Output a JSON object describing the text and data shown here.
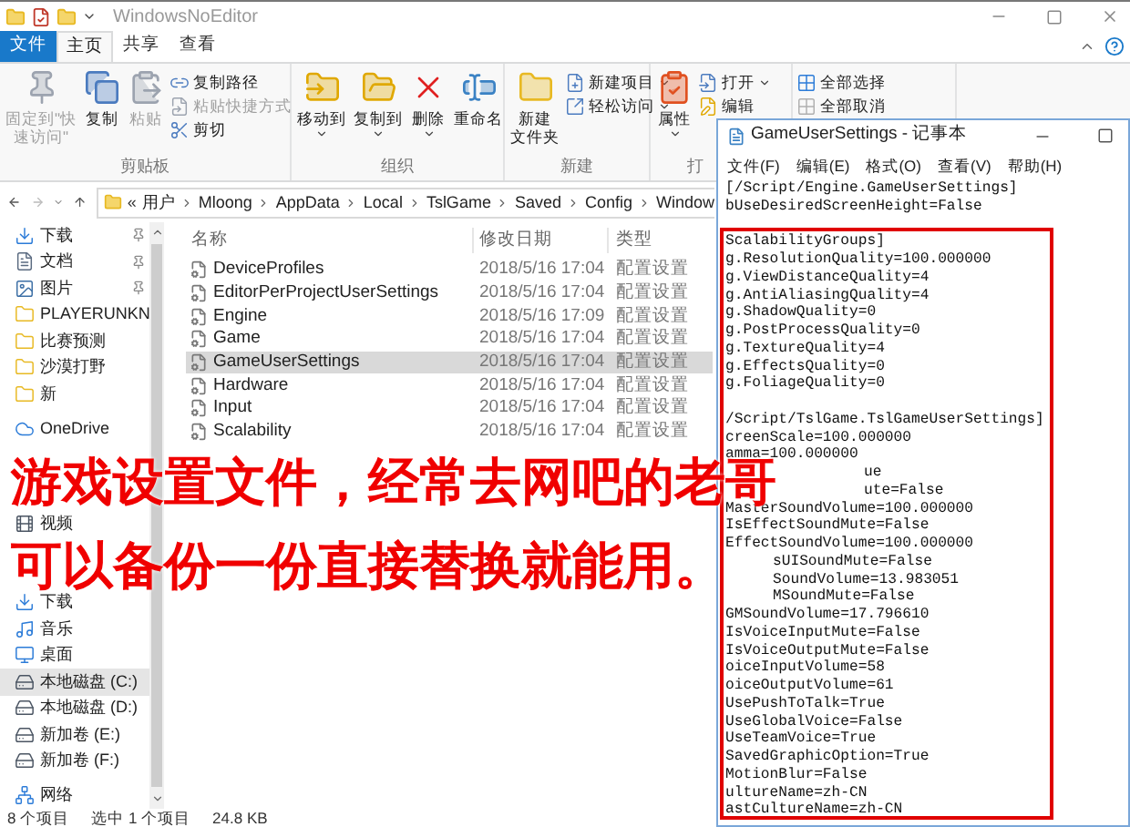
{
  "explorer": {
    "title": "WindowsNoEditor",
    "file_tab": "文件",
    "ribbon_tabs": [
      {
        "label": "主页",
        "selected": true
      },
      {
        "label": "共享",
        "selected": false
      },
      {
        "label": "查看",
        "selected": false
      }
    ],
    "ribbon_groups": [
      {
        "label": "剪贴板",
        "items": [
          {
            "label_lines": [
              "固定到\"快",
              "速访问\""
            ],
            "kind": "large",
            "disabled": true,
            "menu": false
          },
          {
            "label": "复制",
            "kind": "large",
            "disabled": false,
            "menu": false
          },
          {
            "label": "粘贴",
            "kind": "large",
            "disabled": true,
            "menu": false
          },
          {
            "label": "复制路径",
            "kind": "small",
            "disabled": false,
            "menu": false
          },
          {
            "label": "粘贴快捷方式",
            "kind": "small",
            "disabled": true,
            "menu": false
          },
          {
            "label": "剪切",
            "kind": "small",
            "disabled": false,
            "menu": false
          }
        ]
      },
      {
        "label": "组织",
        "items": [
          {
            "label": "移动到",
            "kind": "large",
            "disabled": false,
            "menu": true
          },
          {
            "label": "复制到",
            "kind": "large",
            "disabled": false,
            "menu": true
          },
          {
            "label": "删除",
            "kind": "large",
            "disabled": false,
            "menu": true
          },
          {
            "label": "重命名",
            "kind": "large",
            "disabled": false,
            "menu": false
          }
        ]
      },
      {
        "label": "新建",
        "items": [
          {
            "label_lines": [
              "新建",
              "文件夹"
            ],
            "kind": "large",
            "disabled": false,
            "menu": false
          },
          {
            "label": "新建项目",
            "kind": "small",
            "disabled": false,
            "menu": true
          },
          {
            "label": "轻松访问",
            "kind": "small",
            "disabled": false,
            "menu": true
          }
        ]
      },
      {
        "label": "打",
        "items": [
          {
            "label": "属性",
            "kind": "large",
            "disabled": false,
            "menu": true
          },
          {
            "label": "打开",
            "kind": "small",
            "disabled": false,
            "menu": true
          },
          {
            "label": "编辑",
            "kind": "small",
            "disabled": false,
            "menu": false
          }
        ]
      },
      {
        "items": [
          {
            "label": "全部选择",
            "kind": "small",
            "disabled": false,
            "menu": false
          },
          {
            "label": "全部取消",
            "kind": "small",
            "disabled": false,
            "menu": false
          }
        ]
      }
    ],
    "address": {
      "overflow": "«",
      "crumbs": [
        "用户",
        "Mloong",
        "AppData",
        "Local",
        "TslGame",
        "Saved",
        "Config",
        "Window"
      ]
    },
    "nav": [
      {
        "label": "下载",
        "kind": "download",
        "pinned": true,
        "selected": false
      },
      {
        "label": "文档",
        "kind": "document",
        "pinned": true,
        "selected": false
      },
      {
        "label": "图片",
        "kind": "picture",
        "pinned": true,
        "selected": false
      },
      {
        "label": "PLAYERUNKN",
        "kind": "folder",
        "pinned": false,
        "selected": false
      },
      {
        "label": "比赛预测",
        "kind": "folder",
        "pinned": false,
        "selected": false
      },
      {
        "label": "沙漠打野",
        "kind": "folder",
        "pinned": false,
        "selected": false
      },
      {
        "label": "新",
        "kind": "folder",
        "pinned": false,
        "selected": false
      },
      {
        "label": "OneDrive",
        "kind": "cloud",
        "pinned": false,
        "selected": false
      },
      {
        "kind": "covered"
      },
      {
        "kind": "covered"
      },
      {
        "label": "视频",
        "kind": "video",
        "pinned": false,
        "selected": false
      },
      {
        "kind": "covered"
      },
      {
        "kind": "covered"
      },
      {
        "label": "下载",
        "kind": "download",
        "pinned": false,
        "selected": false
      },
      {
        "label": "音乐",
        "kind": "music",
        "pinned": false,
        "selected": false
      },
      {
        "label": "桌面",
        "kind": "desktop",
        "pinned": false,
        "selected": false
      },
      {
        "label": "本地磁盘 (C:)",
        "kind": "drive",
        "pinned": false,
        "selected": true
      },
      {
        "label": "本地磁盘 (D:)",
        "kind": "drive",
        "pinned": false,
        "selected": false
      },
      {
        "label": "新加卷 (E:)",
        "kind": "drive",
        "pinned": false,
        "selected": false
      },
      {
        "label": "新加卷 (F:)",
        "kind": "drive",
        "pinned": false,
        "selected": false
      },
      {
        "label": "网络",
        "kind": "network",
        "pinned": false,
        "selected": false
      }
    ],
    "columns": [
      "名称",
      "修改日期",
      "类型"
    ],
    "files": [
      {
        "name": "DeviceProfiles",
        "modified": "2018/5/16 17:04",
        "type": "配置设置",
        "selected": false
      },
      {
        "name": "EditorPerProjectUserSettings",
        "modified": "2018/5/16 17:04",
        "type": "配置设置",
        "selected": false
      },
      {
        "name": "Engine",
        "modified": "2018/5/16 17:09",
        "type": "配置设置",
        "selected": false
      },
      {
        "name": "Game",
        "modified": "2018/5/16 17:04",
        "type": "配置设置",
        "selected": false
      },
      {
        "name": "GameUserSettings",
        "modified": "2018/5/16 17:04",
        "type": "配置设置",
        "selected": true
      },
      {
        "name": "Hardware",
        "modified": "2018/5/16 17:04",
        "type": "配置设置",
        "selected": false
      },
      {
        "name": "Input",
        "modified": "2018/5/16 17:04",
        "type": "配置设置",
        "selected": false
      },
      {
        "name": "Scalability",
        "modified": "2018/5/16 17:04",
        "type": "配置设置",
        "selected": false
      }
    ],
    "status_bar": [
      "8 个项目",
      "选中 1 个项目",
      "24.8 KB"
    ]
  },
  "notepad": {
    "title": "GameUserSettings - 记事本",
    "menu": [
      "文件(F)",
      "编辑(E)",
      "格式(O)",
      "查看(V)",
      "帮助(H)"
    ],
    "lines": [
      {
        "kind": "text",
        "text": "[/Script/Engine.GameUserSettings]"
      },
      {
        "kind": "text",
        "text": "bUseDesiredScreenHeight=False"
      },
      {
        "kind": "blank"
      },
      {
        "kind": "text",
        "text": "ScalabilityGroups]"
      },
      {
        "kind": "text",
        "text": "g.ResolutionQuality=100.000000"
      },
      {
        "kind": "text",
        "text": "g.ViewDistanceQuality=4"
      },
      {
        "kind": "text",
        "text": "g.AntiAliasingQuality=4"
      },
      {
        "kind": "text",
        "text": "g.ShadowQuality=0"
      },
      {
        "kind": "text",
        "text": "g.PostProcessQuality=0"
      },
      {
        "kind": "text",
        "text": "g.TextureQuality=4"
      },
      {
        "kind": "text",
        "text": "g.EffectsQuality=0"
      },
      {
        "kind": "text",
        "text": "g.FoliageQuality=0"
      },
      {
        "kind": "blank"
      },
      {
        "kind": "text",
        "text": "/Script/TslGame.TslGameUserSettings]"
      },
      {
        "kind": "text",
        "text": "creenScale=100.000000"
      },
      {
        "kind": "text",
        "text": "amma=100.000000"
      },
      {
        "kind": "behind-long",
        "text": "ue"
      },
      {
        "kind": "behind-long",
        "text": "ute=False"
      },
      {
        "kind": "text",
        "text": "MasterSoundVolume=100.000000"
      },
      {
        "kind": "text",
        "text": "IsEffectSoundMute=False"
      },
      {
        "kind": "text",
        "text": "EffectSoundVolume=100.000000"
      },
      {
        "kind": "behind-short",
        "text": "sUISoundMute=False"
      },
      {
        "kind": "behind-short",
        "text": "SoundVolume=13.983051"
      },
      {
        "kind": "behind-short",
        "text": "MSoundMute=False"
      },
      {
        "kind": "text",
        "text": "GMSoundVolume=17.796610"
      },
      {
        "kind": "text",
        "text": "IsVoiceInputMute=False"
      },
      {
        "kind": "text",
        "text": "IsVoiceOutputMute=False"
      },
      {
        "kind": "text",
        "text": "oiceInputVolume=58"
      },
      {
        "kind": "text",
        "text": "oiceOutputVolume=61"
      },
      {
        "kind": "text",
        "text": "UsePushToTalk=True"
      },
      {
        "kind": "text",
        "text": "UseGlobalVoice=False"
      },
      {
        "kind": "text",
        "text": "UseTeamVoice=True"
      },
      {
        "kind": "text",
        "text": "SavedGraphicOption=True"
      },
      {
        "kind": "text",
        "text": "MotionBlur=False"
      },
      {
        "kind": "text",
        "text": "ultureName=zh-CN"
      },
      {
        "kind": "text",
        "text": "astCultureName=zh-CN"
      }
    ]
  },
  "caption": [
    "游戏设置文件，经常去网吧的老哥",
    "可以备份一份直接替换就能用。"
  ]
}
